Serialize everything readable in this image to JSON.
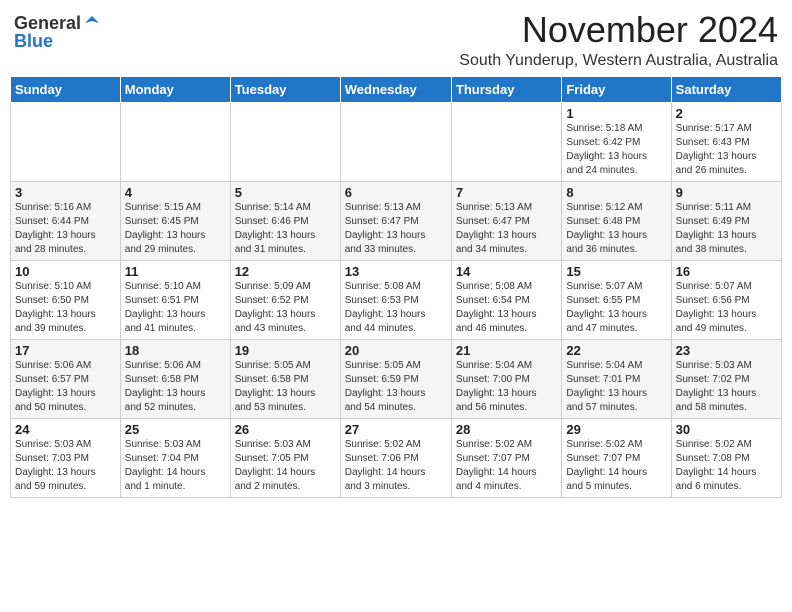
{
  "logo": {
    "general": "General",
    "blue": "Blue"
  },
  "title": "November 2024",
  "location": "South Yunderup, Western Australia, Australia",
  "headers": [
    "Sunday",
    "Monday",
    "Tuesday",
    "Wednesday",
    "Thursday",
    "Friday",
    "Saturday"
  ],
  "weeks": [
    [
      {
        "day": "",
        "info": ""
      },
      {
        "day": "",
        "info": ""
      },
      {
        "day": "",
        "info": ""
      },
      {
        "day": "",
        "info": ""
      },
      {
        "day": "",
        "info": ""
      },
      {
        "day": "1",
        "info": "Sunrise: 5:18 AM\nSunset: 6:42 PM\nDaylight: 13 hours\nand 24 minutes."
      },
      {
        "day": "2",
        "info": "Sunrise: 5:17 AM\nSunset: 6:43 PM\nDaylight: 13 hours\nand 26 minutes."
      }
    ],
    [
      {
        "day": "3",
        "info": "Sunrise: 5:16 AM\nSunset: 6:44 PM\nDaylight: 13 hours\nand 28 minutes."
      },
      {
        "day": "4",
        "info": "Sunrise: 5:15 AM\nSunset: 6:45 PM\nDaylight: 13 hours\nand 29 minutes."
      },
      {
        "day": "5",
        "info": "Sunrise: 5:14 AM\nSunset: 6:46 PM\nDaylight: 13 hours\nand 31 minutes."
      },
      {
        "day": "6",
        "info": "Sunrise: 5:13 AM\nSunset: 6:47 PM\nDaylight: 13 hours\nand 33 minutes."
      },
      {
        "day": "7",
        "info": "Sunrise: 5:13 AM\nSunset: 6:47 PM\nDaylight: 13 hours\nand 34 minutes."
      },
      {
        "day": "8",
        "info": "Sunrise: 5:12 AM\nSunset: 6:48 PM\nDaylight: 13 hours\nand 36 minutes."
      },
      {
        "day": "9",
        "info": "Sunrise: 5:11 AM\nSunset: 6:49 PM\nDaylight: 13 hours\nand 38 minutes."
      }
    ],
    [
      {
        "day": "10",
        "info": "Sunrise: 5:10 AM\nSunset: 6:50 PM\nDaylight: 13 hours\nand 39 minutes."
      },
      {
        "day": "11",
        "info": "Sunrise: 5:10 AM\nSunset: 6:51 PM\nDaylight: 13 hours\nand 41 minutes."
      },
      {
        "day": "12",
        "info": "Sunrise: 5:09 AM\nSunset: 6:52 PM\nDaylight: 13 hours\nand 43 minutes."
      },
      {
        "day": "13",
        "info": "Sunrise: 5:08 AM\nSunset: 6:53 PM\nDaylight: 13 hours\nand 44 minutes."
      },
      {
        "day": "14",
        "info": "Sunrise: 5:08 AM\nSunset: 6:54 PM\nDaylight: 13 hours\nand 46 minutes."
      },
      {
        "day": "15",
        "info": "Sunrise: 5:07 AM\nSunset: 6:55 PM\nDaylight: 13 hours\nand 47 minutes."
      },
      {
        "day": "16",
        "info": "Sunrise: 5:07 AM\nSunset: 6:56 PM\nDaylight: 13 hours\nand 49 minutes."
      }
    ],
    [
      {
        "day": "17",
        "info": "Sunrise: 5:06 AM\nSunset: 6:57 PM\nDaylight: 13 hours\nand 50 minutes."
      },
      {
        "day": "18",
        "info": "Sunrise: 5:06 AM\nSunset: 6:58 PM\nDaylight: 13 hours\nand 52 minutes."
      },
      {
        "day": "19",
        "info": "Sunrise: 5:05 AM\nSunset: 6:58 PM\nDaylight: 13 hours\nand 53 minutes."
      },
      {
        "day": "20",
        "info": "Sunrise: 5:05 AM\nSunset: 6:59 PM\nDaylight: 13 hours\nand 54 minutes."
      },
      {
        "day": "21",
        "info": "Sunrise: 5:04 AM\nSunset: 7:00 PM\nDaylight: 13 hours\nand 56 minutes."
      },
      {
        "day": "22",
        "info": "Sunrise: 5:04 AM\nSunset: 7:01 PM\nDaylight: 13 hours\nand 57 minutes."
      },
      {
        "day": "23",
        "info": "Sunrise: 5:03 AM\nSunset: 7:02 PM\nDaylight: 13 hours\nand 58 minutes."
      }
    ],
    [
      {
        "day": "24",
        "info": "Sunrise: 5:03 AM\nSunset: 7:03 PM\nDaylight: 13 hours\nand 59 minutes."
      },
      {
        "day": "25",
        "info": "Sunrise: 5:03 AM\nSunset: 7:04 PM\nDaylight: 14 hours\nand 1 minute."
      },
      {
        "day": "26",
        "info": "Sunrise: 5:03 AM\nSunset: 7:05 PM\nDaylight: 14 hours\nand 2 minutes."
      },
      {
        "day": "27",
        "info": "Sunrise: 5:02 AM\nSunset: 7:06 PM\nDaylight: 14 hours\nand 3 minutes."
      },
      {
        "day": "28",
        "info": "Sunrise: 5:02 AM\nSunset: 7:07 PM\nDaylight: 14 hours\nand 4 minutes."
      },
      {
        "day": "29",
        "info": "Sunrise: 5:02 AM\nSunset: 7:07 PM\nDaylight: 14 hours\nand 5 minutes."
      },
      {
        "day": "30",
        "info": "Sunrise: 5:02 AM\nSunset: 7:08 PM\nDaylight: 14 hours\nand 6 minutes."
      }
    ]
  ]
}
